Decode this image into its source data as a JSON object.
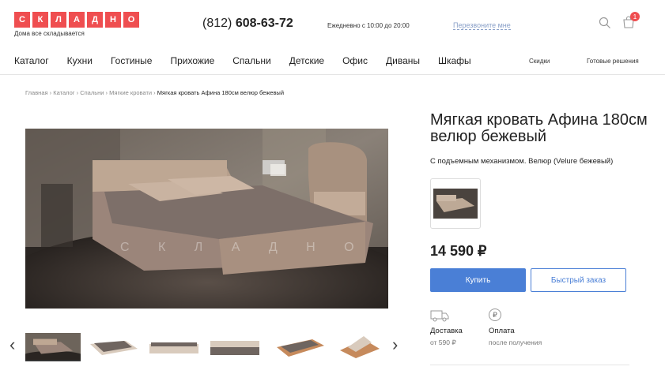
{
  "logo": {
    "letters": [
      "С",
      "К",
      "Л",
      "А",
      "Д",
      "Н",
      "О"
    ],
    "tagline": "Дома все складывается"
  },
  "header": {
    "phone_code": "(812)",
    "phone_number": "608-63-72",
    "hours": "Ежедневно с 10:00 до 20:00",
    "callback": "Перезвоните мне",
    "cart_count": "1"
  },
  "nav": {
    "items": [
      "Каталог",
      "Кухни",
      "Гостиные",
      "Прихожие",
      "Спальни",
      "Детские",
      "Офис",
      "Диваны",
      "Шкафы"
    ],
    "discounts": "Скидки",
    "ready": "Готовые решения"
  },
  "breadcrumb": {
    "items": [
      "Главная",
      "Каталог",
      "Спальни",
      "Мягкие кровати"
    ],
    "current": "Мягкая кровать Афина 180см велюр бежевый",
    "separator": "›"
  },
  "product": {
    "title": "Мягкая кровать Афина 180см велюр бежевый",
    "subtitle": "С подъемным механизмом. Велюр (Velure бежевый)",
    "price": "14 590 ₽",
    "buy_label": "Купить",
    "quick_order_label": "Быстрый заказ",
    "watermark": "С К Л А Д Н О"
  },
  "delivery": {
    "title": "Доставка",
    "sub": "от 590 ₽"
  },
  "payment": {
    "title": "Оплата",
    "sub": "после получения",
    "icon_glyph": "₽"
  },
  "gallery": {
    "prev_glyph": "‹",
    "next_glyph": "›"
  },
  "colors": {
    "brand_red": "#ef4e50",
    "accent_blue": "#4a7fd6",
    "bed_beige": "#b89a86"
  }
}
